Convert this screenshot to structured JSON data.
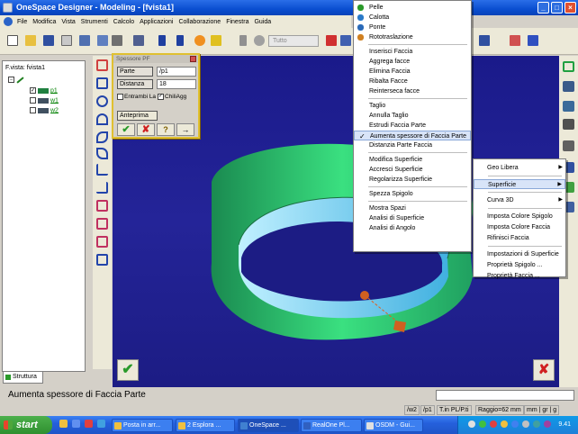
{
  "window": {
    "title": "OneSpace Designer - Modeling - [fvista1]",
    "min": "_",
    "max": "□",
    "close": "×"
  },
  "menubar": [
    "File",
    "Modifica",
    "Vista",
    "Strumenti",
    "Calcolo",
    "Applicazioni",
    "Collaborazione",
    "Finestra",
    "Guida"
  ],
  "toolbar": {
    "combo_value": "Tutto"
  },
  "tree": {
    "title": "F.vista: fvista1",
    "items": [
      {
        "label": "p1",
        "checked": true
      },
      {
        "label": "w1",
        "checked": false
      },
      {
        "label": "w2",
        "checked": false
      }
    ],
    "tab": "Struttura"
  },
  "dialog": {
    "title": "Spessore PF",
    "parte_label": "Parte",
    "parte_value": "/p1",
    "distanza_label": "Distanza",
    "distanza_value": "18",
    "entrambi_label": "Entrambi La",
    "entrambi_checked": false,
    "chiagg_label": "ChiliAgg",
    "chiagg_checked": true,
    "anteprima_label": "Anteprima",
    "ok_glyph": "✔",
    "cancel_glyph": "✘",
    "help_glyph": "?",
    "pin_glyph": "→"
  },
  "menu1": {
    "items": [
      {
        "label": "Pelle",
        "icon": "pelle-icon"
      },
      {
        "label": "Calotta",
        "icon": "calotta-icon"
      },
      {
        "label": "Ponte",
        "icon": "ponte-icon"
      },
      {
        "label": "Rototraslazione",
        "icon": "rototraslazione-icon"
      },
      {
        "sep": true
      },
      {
        "label": "Inserisci Faccia"
      },
      {
        "label": "Aggrega facce"
      },
      {
        "label": "Elimina Faccia"
      },
      {
        "label": "Ribalta Facce"
      },
      {
        "label": "Reinterseca facce"
      },
      {
        "sep": true
      },
      {
        "label": "Taglio"
      },
      {
        "label": "Annulla Taglio"
      },
      {
        "label": "Estrudi Faccia Parte"
      },
      {
        "label": "Aumenta spessore di Faccia Parte",
        "checked": true,
        "highlight": true
      },
      {
        "label": "Distanzia Parte Faccia"
      },
      {
        "sep": true
      },
      {
        "label": "Modifica Superficie"
      },
      {
        "label": "Accresci Superficie"
      },
      {
        "label": "Regolarizza Superficie"
      },
      {
        "sep": true
      },
      {
        "label": "Spezza Spigolo"
      },
      {
        "sep": true
      },
      {
        "label": "Mostra Spazi"
      },
      {
        "label": "Analisi di Superficie"
      },
      {
        "label": "Analisi di Angolo"
      }
    ]
  },
  "menu2": {
    "items": [
      {
        "label": "Geo Libera",
        "arrow": true
      },
      {
        "sep": true
      },
      {
        "label": "Superficie",
        "arrow": true,
        "highlight": true
      },
      {
        "sep": true
      },
      {
        "label": "Curva 3D",
        "arrow": true
      },
      {
        "sep": true
      },
      {
        "label": "Imposta Colore Spigolo"
      },
      {
        "label": "Imposta Colore Faccia"
      },
      {
        "label": "Rifinisci Faccia"
      },
      {
        "sep": true
      },
      {
        "label": "Impostazioni di Superficie"
      },
      {
        "label": "Proprietà Spigolo ..."
      },
      {
        "label": "Proprietà Faccia ..."
      }
    ]
  },
  "viewport": {
    "ok_glyph": "✔",
    "cancel_glyph": "✘"
  },
  "command_line": {
    "message": "Aumenta spessore di Faccia Parte"
  },
  "status": [
    "/w2",
    "/p1",
    "T.in PL/P.ti",
    "Raggio=62 mm",
    "mm | gr | g"
  ],
  "taskbar": {
    "start": "start",
    "tasks": [
      "Posta in arr...",
      "2 Esplora ...",
      "OneSpace ...",
      "RealOne Pl...",
      "OSDM - Gui..."
    ],
    "clock": "9.41"
  }
}
